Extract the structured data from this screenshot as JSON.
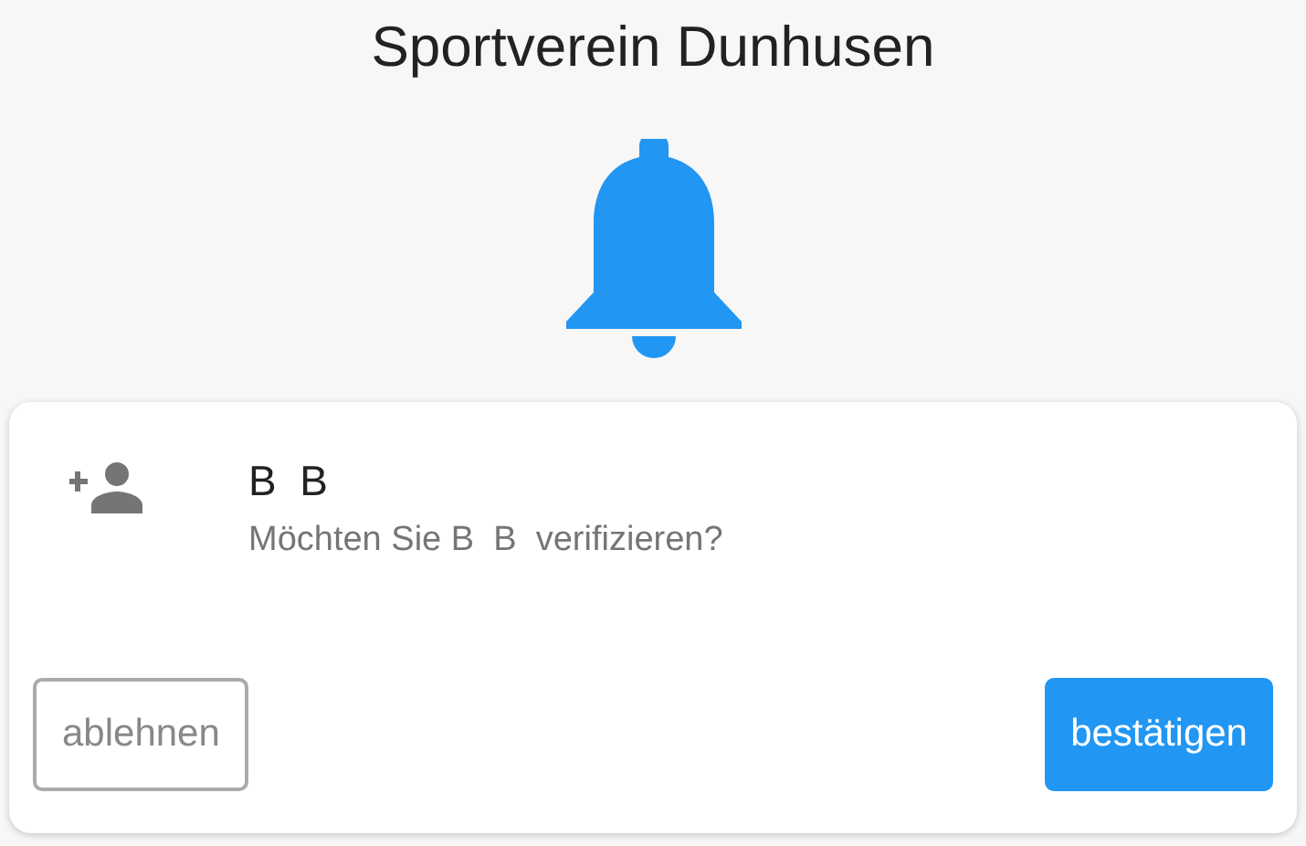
{
  "header": {
    "title": "Sportverein Dunhusen"
  },
  "request": {
    "name": "B  B",
    "message": "Möchten Sie B  B  verifizieren?"
  },
  "actions": [
    {
      "label": "ablehnen",
      "kind": "outlined"
    },
    {
      "label": "bestätigen",
      "kind": "filled"
    }
  ]
}
